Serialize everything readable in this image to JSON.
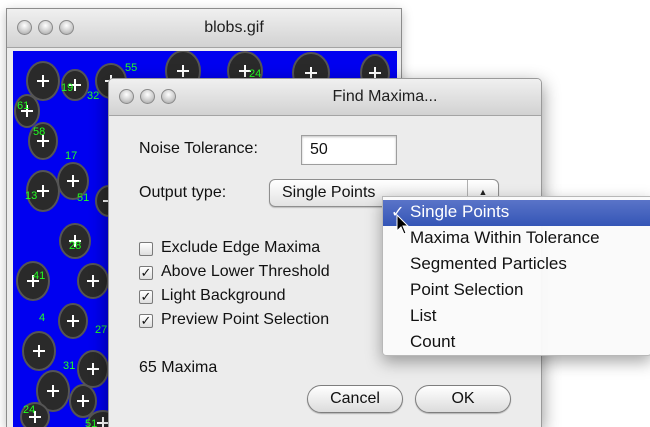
{
  "image_window": {
    "title": "blobs.gif",
    "labels": [
      "55",
      "24",
      "19",
      "32",
      "61",
      "58",
      "17",
      "13",
      "51",
      "28",
      "41",
      "4",
      "27",
      "31",
      "24",
      "51"
    ]
  },
  "dialog": {
    "title": "Find Maxima...",
    "noise_label": "Noise Tolerance:",
    "noise_value": "50",
    "output_label": "Output type:",
    "output_value": "Single Points",
    "checkboxes": [
      {
        "label": "Exclude Edge Maxima",
        "checked": false
      },
      {
        "label": "Above Lower Threshold",
        "checked": true
      },
      {
        "label": "Light Background",
        "checked": true
      },
      {
        "label": "Preview Point Selection",
        "checked": true
      }
    ],
    "status": "65 Maxima",
    "cancel_label": "Cancel",
    "ok_label": "OK"
  },
  "menu": {
    "items": [
      {
        "label": "Single Points",
        "selected": true
      },
      {
        "label": "Maxima Within Tolerance",
        "selected": false
      },
      {
        "label": "Segmented Particles",
        "selected": false
      },
      {
        "label": "Point Selection",
        "selected": false
      },
      {
        "label": "List",
        "selected": false
      },
      {
        "label": "Count",
        "selected": false
      }
    ]
  },
  "colors": {
    "canvas_bg": "#0000f0",
    "blob": "#2a2a2a",
    "marker": "#ffffff",
    "label": "#22ff22",
    "menu_highlight": "#3f5fc0"
  },
  "icons": [
    "check-icon",
    "arrow-cursor-icon",
    "stepper-arrows-icon"
  ]
}
